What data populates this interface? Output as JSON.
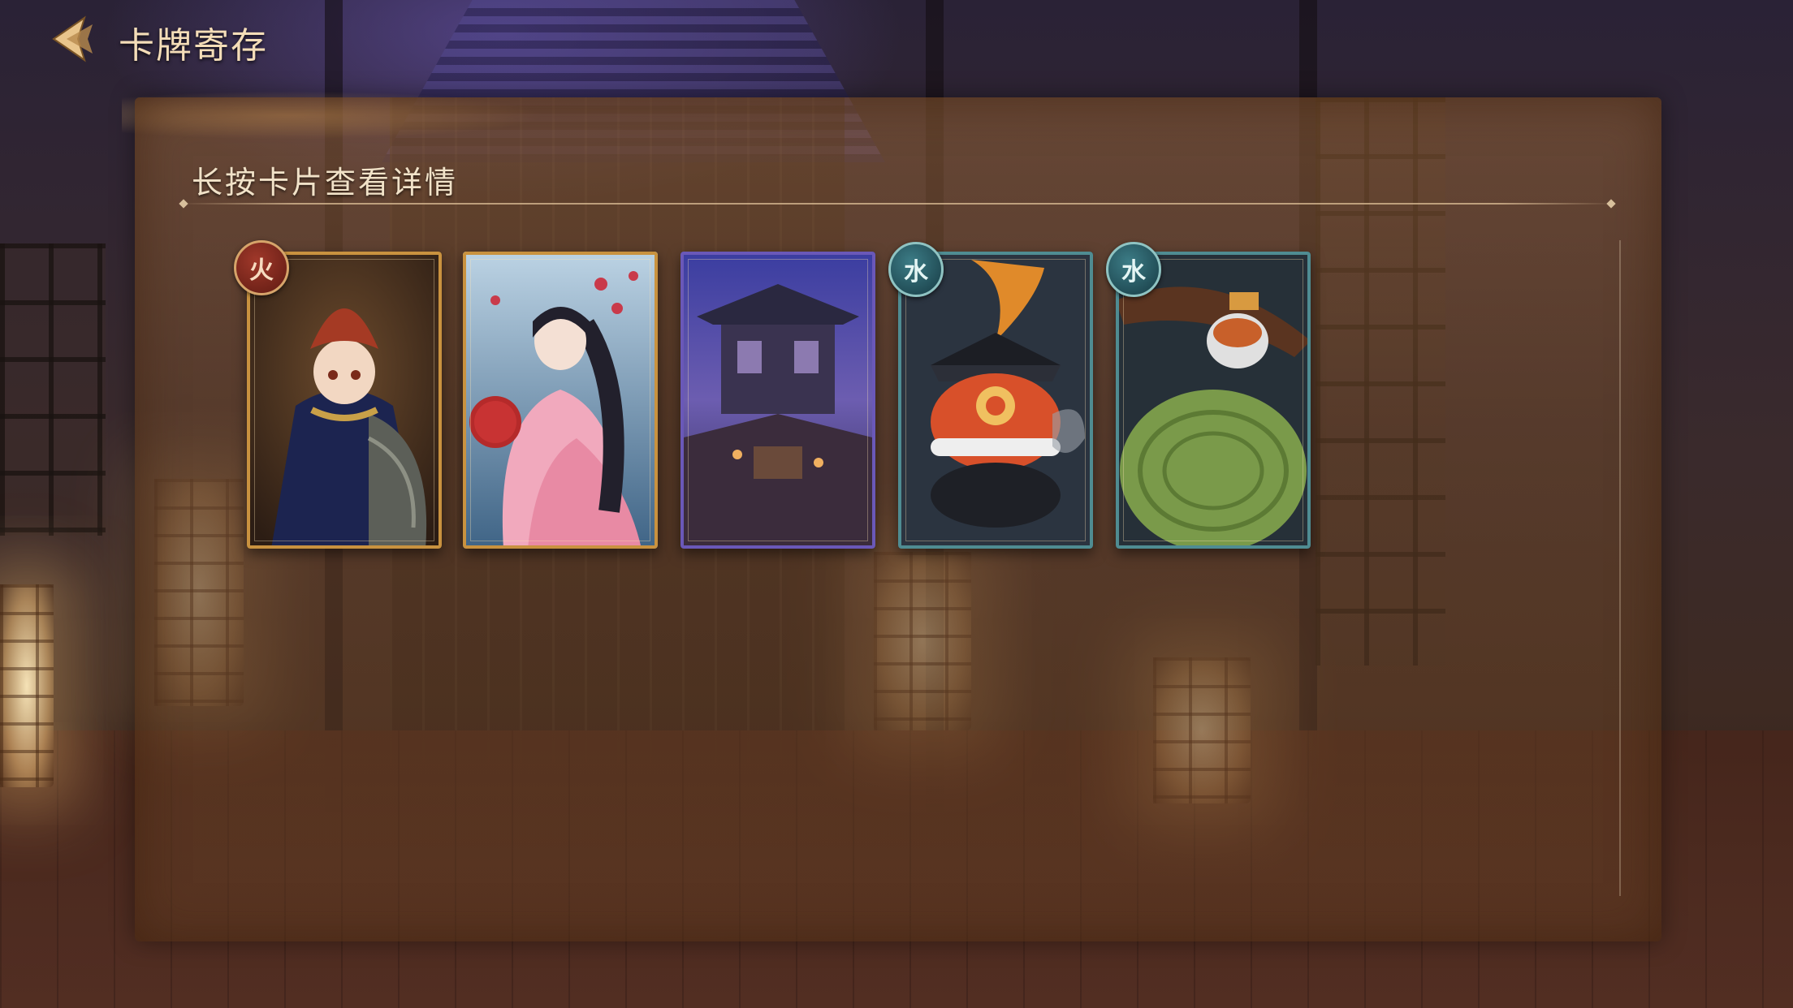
{
  "header": {
    "title": "卡牌寄存",
    "back_icon": "chevron-left-icon"
  },
  "panel": {
    "instruction": "长按卡片查看详情"
  },
  "cards": [
    {
      "name": "card-fire-character",
      "element": "火",
      "element_type": "fire",
      "frame_color": "#c9923f",
      "art": "girl with red hat and feather cloak"
    },
    {
      "name": "card-pink-kimono",
      "element": "",
      "element_type": "none",
      "frame_color": "#c9923f",
      "art": "fox-eared girl in pink kimono"
    },
    {
      "name": "card-shrine-scene",
      "element": "",
      "element_type": "none",
      "frame_color": "#6a58b8",
      "art": "night shrine building"
    },
    {
      "name": "card-water-lantern-creature",
      "element": "水",
      "element_type": "water",
      "frame_color": "#4f8c92",
      "art": "red creature with black helmet"
    },
    {
      "name": "card-water-turtle-rider",
      "element": "水",
      "element_type": "water",
      "frame_color": "#4f8c92",
      "art": "red panda with straw hat on green turtle shell"
    }
  ],
  "colors": {
    "title_text": "#f4ddb8",
    "instruction_text": "#f1e2c8",
    "panel_tint": "#8c5e34"
  }
}
